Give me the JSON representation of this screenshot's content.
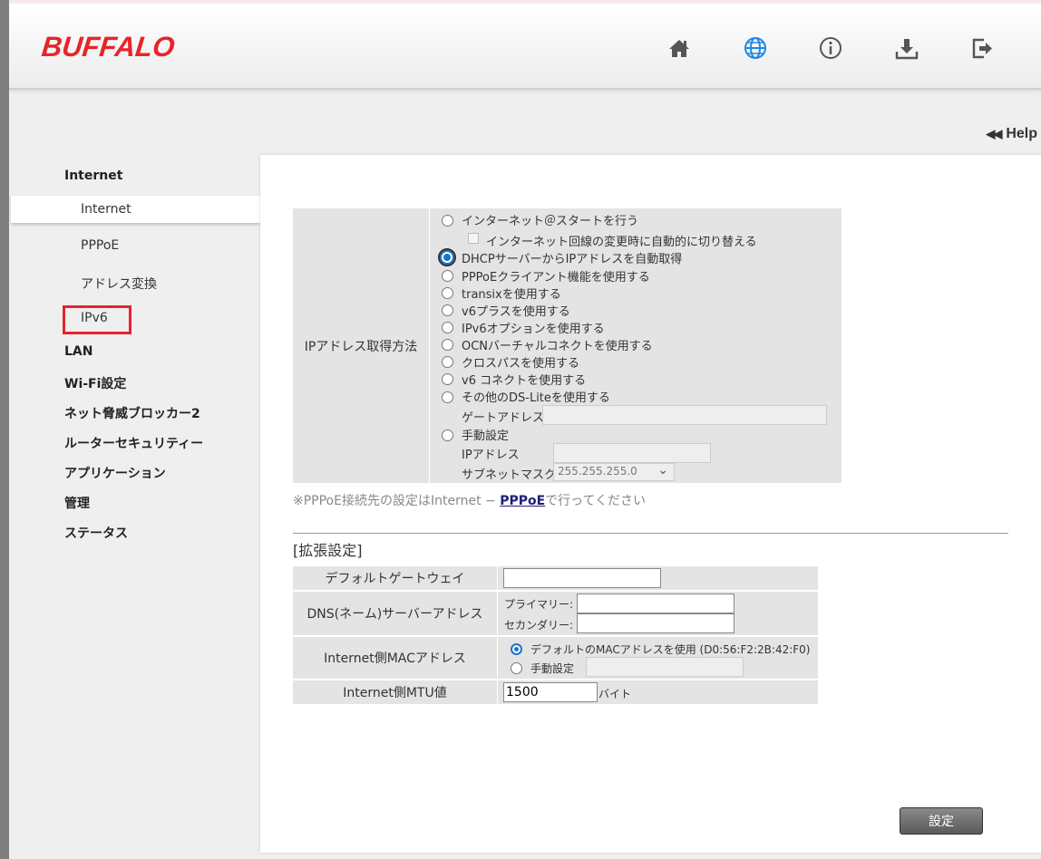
{
  "brand": {
    "logo": "BUFFALO",
    "accent": "#e8232a"
  },
  "header_icons": [
    "home-icon",
    "globe-icon",
    "info-icon",
    "download-icon",
    "logout-icon"
  ],
  "help": {
    "label": "Help"
  },
  "nav": {
    "internet": "Internet",
    "sub_internet": "Internet",
    "sub_pppoe": "PPPoE",
    "sub_nat": "アドレス変換",
    "sub_ipv6": "IPv6",
    "lan": "LAN",
    "wifi": "Wi-Fi設定",
    "blocker": "ネット脅威ブロッカー2",
    "security": "ルーターセキュリティー",
    "apps": "アプリケーション",
    "admin": "管理",
    "status": "ステータス"
  },
  "ipform": {
    "label": "IPアドレス取得方法",
    "opt_start": "インターネット＠スタートを行う",
    "opt_autoswitch": "インターネット回線の変更時に自動的に切り替える",
    "opt_dhcp": "DHCPサーバーからIPアドレスを自動取得",
    "opt_pppoe": "PPPoEクライアント機能を使用する",
    "opt_transix": "transixを使用する",
    "opt_v6plus": "v6プラスを使用する",
    "opt_ipv6opt": "IPv6オプションを使用する",
    "opt_ocn": "OCNバーチャルコネクトを使用する",
    "opt_crosspath": "クロスパスを使用する",
    "opt_v6connect": "v6 コネクトを使用する",
    "opt_dslite": "その他のDS-Liteを使用する",
    "gateway_label": "ゲートアドレス",
    "opt_manual": "手動設定",
    "ip_label": "IPアドレス",
    "subnet_label": "サブネットマスク",
    "subnet_value": "255.255.255.0"
  },
  "note": {
    "text": "※PPPoE接続先の設定はInternet − ",
    "link": "PPPoE",
    "tail": "で行ってください"
  },
  "ext": {
    "title": "[拡張設定]",
    "gateway_label": "デフォルトゲートウェイ",
    "dns_label": "DNS(ネーム)サーバーアドレス",
    "dns_primary": "プライマリー:",
    "dns_secondary": "セカンダリー:",
    "mac_label": "Internet側MACアドレス",
    "mac_default": "デフォルトのMACアドレスを使用 (D0:56:F2:2B:42:F0)",
    "mac_manual": "手動設定",
    "mtu_label": "Internet側MTU値",
    "mtu_value": "1500",
    "mtu_unit": "バイト"
  },
  "submit": {
    "label": "設定"
  }
}
